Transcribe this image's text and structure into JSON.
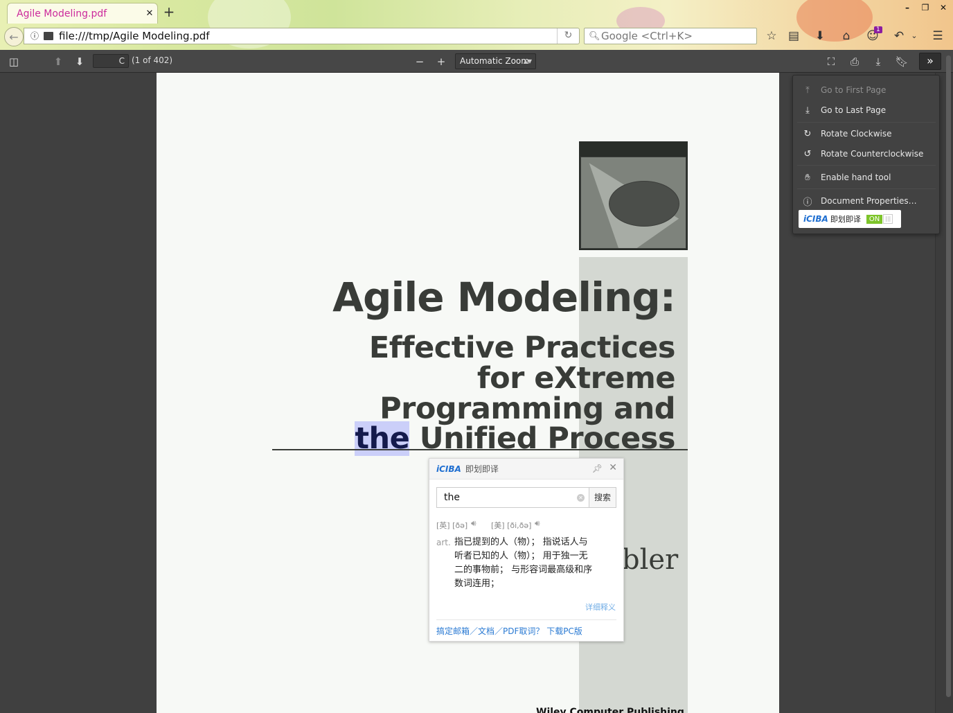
{
  "browser": {
    "tab_title": "Agile Modeling.pdf",
    "url": "file:///tmp/Agile Modeling.pdf",
    "search_placeholder": "Google <Ctrl+K>",
    "notification_count": "1"
  },
  "pdf_toolbar": {
    "page_number": "C",
    "page_count": "(1 of 402)",
    "zoom": "Automatic Zoom"
  },
  "secondary_menu": {
    "items": [
      {
        "label": "Go to First Page",
        "icon": "first-page-icon",
        "enabled": false
      },
      {
        "label": "Go to Last Page",
        "icon": "last-page-icon",
        "enabled": true
      },
      {
        "label": "Rotate Clockwise",
        "icon": "rotate-cw-icon",
        "enabled": true
      },
      {
        "label": "Rotate Counterclockwise",
        "icon": "rotate-ccw-icon",
        "enabled": true
      },
      {
        "label": "Enable hand tool",
        "icon": "hand-icon",
        "enabled": true
      },
      {
        "label": "Document Properties…",
        "icon": "info-icon",
        "enabled": true
      }
    ],
    "iciba": {
      "logo": "iCIBA",
      "name": "即划即译",
      "state": "ON"
    }
  },
  "document": {
    "title": "Agile Modeling:",
    "subtitle_lines": [
      "Effective Practices",
      "for eXtreme",
      "Programming and"
    ],
    "subtitle_last_highlight": "the",
    "subtitle_last_rest": " Unified Process",
    "author_fragment": "bler",
    "publisher_fragment": "Wiley Computer Publishing"
  },
  "dictionary_popup": {
    "logo": "iCIBA",
    "title": "即划即译",
    "query": "the",
    "search_button": "搜索",
    "uk_phonetic": "[英] [ðə]",
    "us_phonetic": "[美] [ði,ðə]",
    "part_of_speech": "art.",
    "definition": "指已提到的人（物）； 指说话人与听者已知的人（物）； 用于独一无二的事物前； 与形容词最高级和序数词连用；",
    "more_link": "详细释义",
    "footer_link": "搞定邮箱／文档／PDF取词？ 下载PC版"
  },
  "colors": {
    "tab_title": "#cc2a9c",
    "pdf_toolbar": "#474747",
    "highlight": "#8c96ff",
    "iciba_blue": "#1f6fd1",
    "iciba_on": "#7dc42a"
  }
}
